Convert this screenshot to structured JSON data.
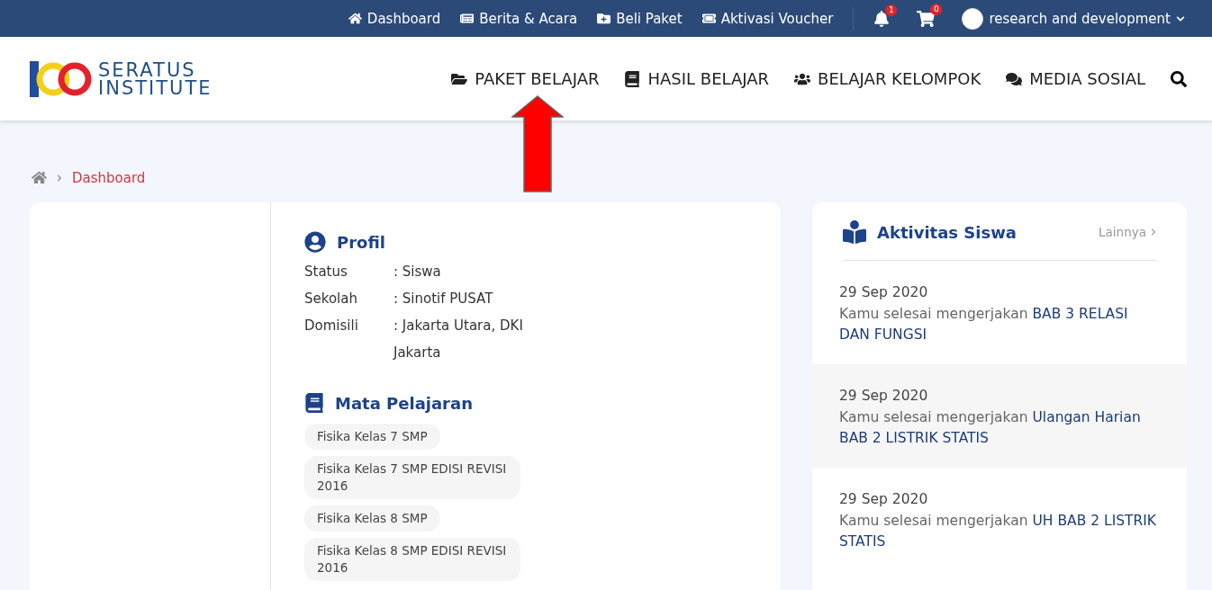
{
  "top_bar": {
    "links": [
      {
        "label": "Dashboard",
        "kind": "home"
      },
      {
        "label": "Berita & Acara",
        "kind": "news"
      },
      {
        "label": "Beli Paket",
        "kind": "folder"
      },
      {
        "label": "Aktivasi Voucher",
        "kind": "ticket"
      }
    ],
    "notifications": "1",
    "cart": "0",
    "user": "research and development"
  },
  "logo": {
    "line_1": "SERATUS",
    "line_2": "INSTITUTE"
  },
  "nav": [
    {
      "label": "PAKET BELAJAR",
      "kind": "folder"
    },
    {
      "label": "HASIL BELAJAR",
      "kind": "book"
    },
    {
      "label": "BELAJAR KELOMPOK",
      "kind": "users"
    },
    {
      "label": "MEDIA SOSIAL",
      "kind": "chat"
    }
  ],
  "breadcrumb": [
    "Dashboard"
  ],
  "profile": {
    "title": "Profil",
    "rows": [
      {
        "label": "Status",
        "value": ": Siswa"
      },
      {
        "label": "Sekolah",
        "value": ": Sinotif PUSAT"
      },
      {
        "label": "Domisili",
        "value": ": Jakarta Utara, DKI Jakarta"
      }
    ]
  },
  "subjects": {
    "title": "Mata Pelajaran",
    "items": [
      "Fisika Kelas 7 SMP",
      "Fisika Kelas 7 SMP EDISI REVISI 2016",
      "Fisika Kelas 8 SMP",
      "Fisika Kelas 8 SMP EDISI REVISI 2016"
    ]
  },
  "activity": {
    "title": "Aktivitas Siswa",
    "more": "Lainnya",
    "items": [
      {
        "date": "29 Sep 2020",
        "prefix": "Kamu selesai mengerjakan",
        "subject": "BAB 3 RELASI DAN FUNGSI"
      },
      {
        "date": "29 Sep 2020",
        "prefix": "Kamu selesai mengerjakan",
        "subject": "Ulangan Harian BAB 2 LISTRIK STATIS"
      },
      {
        "date": "29 Sep 2020",
        "prefix": "Kamu selesai mengerjakan",
        "subject": "UH BAB 2 LISTRIK STATIS"
      }
    ]
  }
}
